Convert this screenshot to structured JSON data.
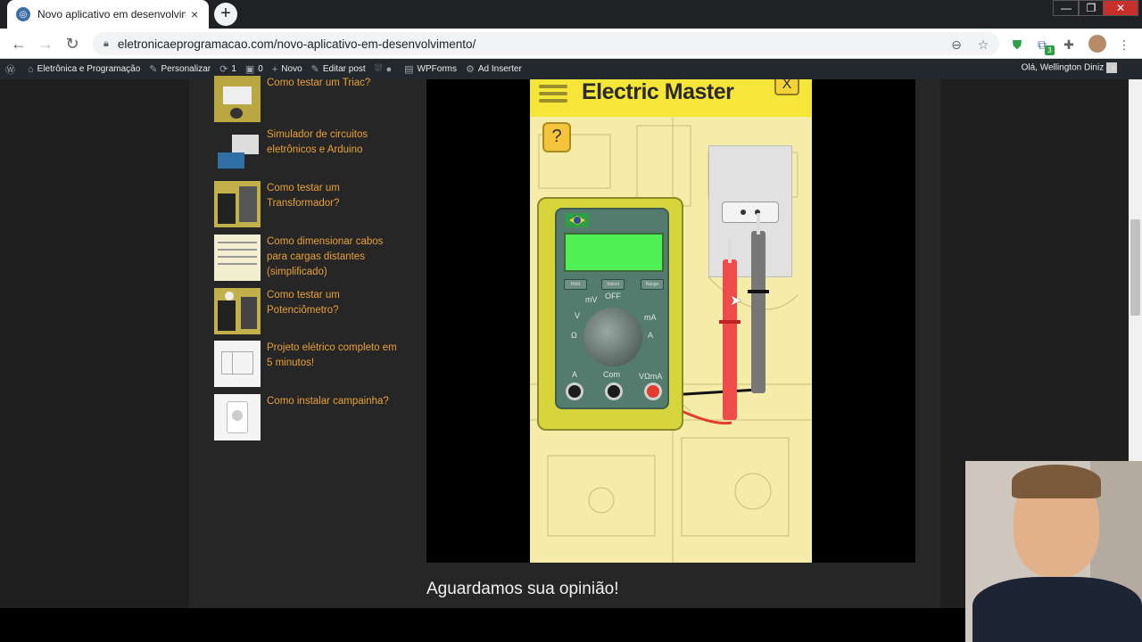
{
  "browser": {
    "tab_title": "Novo aplicativo em desenvolvime",
    "tab_close": "×",
    "new_tab": "+",
    "window_buttons": [
      "—",
      "❐",
      "✕"
    ],
    "url": "eletronicaeprogramacao.com/novo-aplicativo-em-desenvolvimento/",
    "extension_badge": "3"
  },
  "wp_admin_bar": {
    "site_name": "Eletrônica e Programação",
    "customize": "Personalizar",
    "updates_count": "1",
    "comments_count": "0",
    "new": "Novo",
    "edit_post": "Editar post",
    "wpforms": "WPForms",
    "ad_inserter": "Ad Inserter",
    "greeting": "Olá, Wellington Diniz"
  },
  "sidebar_posts": [
    {
      "title": "Como testar um Triac?"
    },
    {
      "title": "Simulador de circuitos eletrônicos e Arduino"
    },
    {
      "title": "Como testar um Transformador?"
    },
    {
      "title": "Como dimensionar cabos para cargas distantes (simplificado)"
    },
    {
      "title": "Como testar um Potenciômetro?"
    },
    {
      "title": "Projeto elétrico completo em 5 minutos!"
    },
    {
      "title": "Como instalar campainha?"
    }
  ],
  "app": {
    "title": "Electric Master",
    "close_label": "X",
    "help_label": "?",
    "meter_buttons": [
      "Hold",
      "Select",
      "Range"
    ],
    "dial_labels": [
      "OFF",
      "mV",
      "V",
      "Ω",
      "mA",
      "A"
    ],
    "jack_labels": [
      "A",
      "Com",
      "VΩmA"
    ]
  },
  "caption": "Aguardamos sua opinião!",
  "colors": {
    "link": "#e8a13a",
    "app_header": "#f6e63a",
    "meter_display": "#4ef055"
  }
}
